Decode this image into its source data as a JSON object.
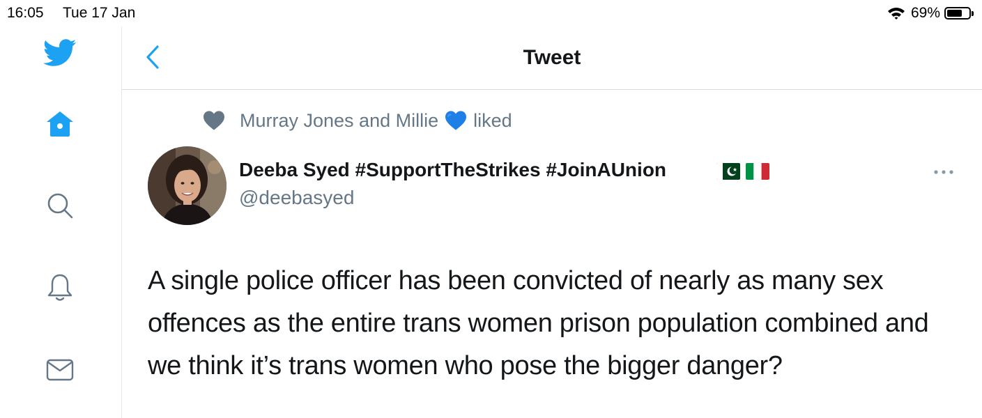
{
  "status_bar": {
    "time": "16:05",
    "date": "Tue 17 Jan",
    "battery_percent": "69%",
    "battery_level": 0.69
  },
  "sidebar": {
    "items": [
      {
        "icon": "twitter-bird-icon"
      },
      {
        "icon": "home-icon"
      },
      {
        "icon": "search-icon"
      },
      {
        "icon": "bell-icon"
      },
      {
        "icon": "mail-icon"
      }
    ]
  },
  "header": {
    "title": "Tweet",
    "back_icon": "chevron-left-icon"
  },
  "tweet": {
    "social_context": {
      "names": "Murray Jones and Millie",
      "emoji": "blue-heart",
      "action": "liked"
    },
    "author": {
      "name": "Deeba Syed #SupportTheStrikes #JoinAUnion",
      "flags": [
        "pakistan-flag",
        "italy-flag"
      ],
      "handle": "@deebasyed"
    },
    "text": "A single police officer has been  convicted of nearly as many sex offences as the entire trans women prison population combined and we think it’s trans women who pose the bigger danger?"
  },
  "colors": {
    "accent": "#1da1f2",
    "icon_gray": "#657786",
    "text": "#14171a",
    "border": "#e1e8ed"
  }
}
